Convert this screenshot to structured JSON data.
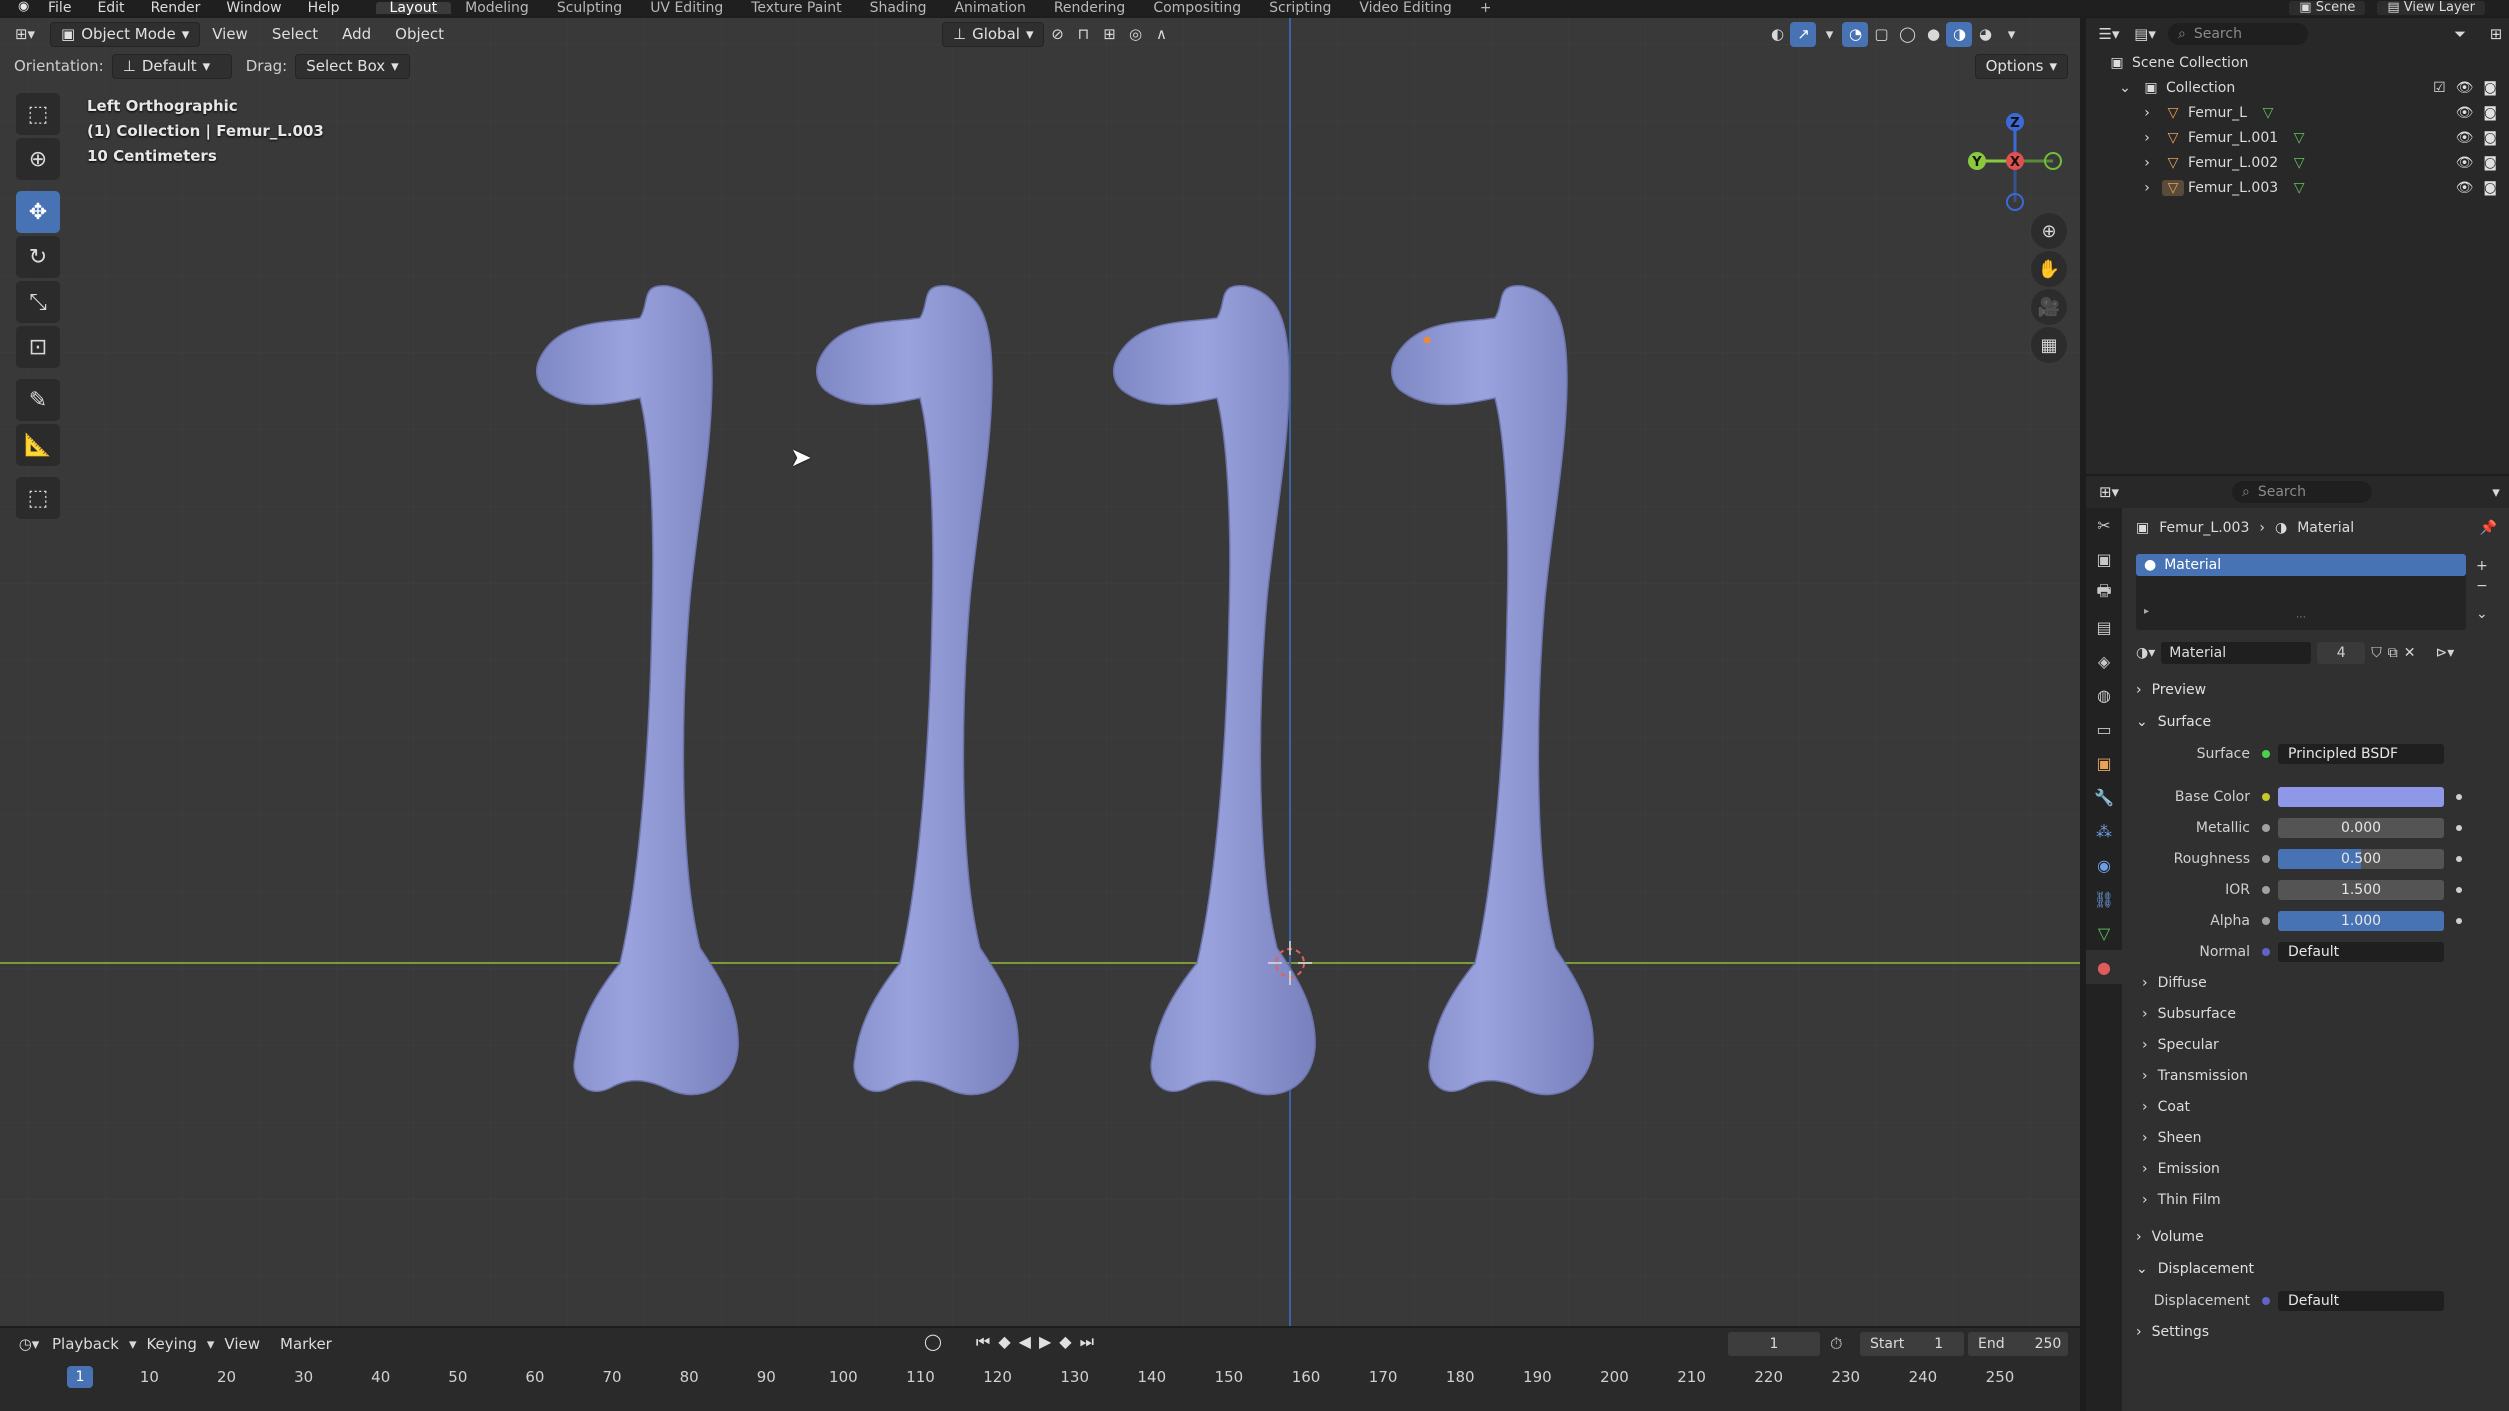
{
  "topbar": {
    "menus": [
      "File",
      "Edit",
      "Render",
      "Window",
      "Help"
    ],
    "workspaces": [
      "Layout",
      "Modeling",
      "Sculpting",
      "UV Editing",
      "Texture Paint",
      "Shading",
      "Animation",
      "Rendering",
      "Compositing",
      "Scripting",
      "Video Editing"
    ],
    "active_workspace": "Layout",
    "scene": "Scene",
    "view_layer": "View Layer"
  },
  "viewport": {
    "mode": "Object Mode",
    "menu": [
      "View",
      "Select",
      "Add",
      "Object"
    ],
    "transform_orientation": "Global",
    "orientation_label": "Orientation:",
    "orientation_value": "Default",
    "drag_label": "Drag:",
    "drag_value": "Select Box",
    "options": "Options",
    "overlay_line1": "Left Orthographic",
    "overlay_line2": "(1) Collection | Femur_L.003",
    "overlay_line3": "10 Centimeters",
    "gizmo_labels": {
      "z": "Z",
      "y": "Y",
      "x": "X"
    },
    "bone_color": "#8f98d4"
  },
  "outliner": {
    "search_placeholder": "Search",
    "scene_collection": "Scene Collection",
    "collection": "Collection",
    "objects": [
      "Femur_L",
      "Femur_L.001",
      "Femur_L.002",
      "Femur_L.003"
    ]
  },
  "properties": {
    "search_placeholder": "Search",
    "breadcrumb_object": "Femur_L.003",
    "breadcrumb_material": "Material",
    "slot_name": "Material",
    "material_name": "Material",
    "user_count": "4",
    "panels": {
      "preview": "Preview",
      "surface": "Surface",
      "volume": "Volume",
      "displacement": "Displacement",
      "settings": "Settings"
    },
    "surface_rows": [
      {
        "label": "Surface",
        "value": "Principled BSDF"
      },
      {
        "label": "Base Color",
        "value": ""
      },
      {
        "label": "Metallic",
        "value": "0.000"
      },
      {
        "label": "Roughness",
        "value": "0.500"
      },
      {
        "label": "IOR",
        "value": "1.500"
      },
      {
        "label": "Alpha",
        "value": "1.000"
      },
      {
        "label": "Normal",
        "value": "Default"
      }
    ],
    "base_color_swatch": "#8f98e8",
    "subpanels": [
      "Diffuse",
      "Subsurface",
      "Specular",
      "Transmission",
      "Coat",
      "Sheen",
      "Emission",
      "Thin Film"
    ],
    "displacement_label": "Displacement",
    "displacement_value": "Default",
    "roughness_fraction": 0.5,
    "alpha_fraction": 1.0
  },
  "timeline": {
    "menus": [
      "Playback",
      "Keying",
      "View",
      "Marker"
    ],
    "current_frame": "1",
    "start_label": "Start",
    "start_value": "1",
    "end_label": "End",
    "end_value": "250",
    "ruler_ticks": [
      "1",
      "10",
      "20",
      "30",
      "40",
      "50",
      "60",
      "70",
      "80",
      "90",
      "100",
      "110",
      "120",
      "130",
      "140",
      "150",
      "160",
      "170",
      "180",
      "190",
      "200",
      "210",
      "220",
      "230",
      "240",
      "250"
    ]
  },
  "icons": {
    "colors": {
      "accent": "#4772b3",
      "selection": "#334d80",
      "object": "#e8a15a",
      "mesh": "#62c25d"
    }
  }
}
